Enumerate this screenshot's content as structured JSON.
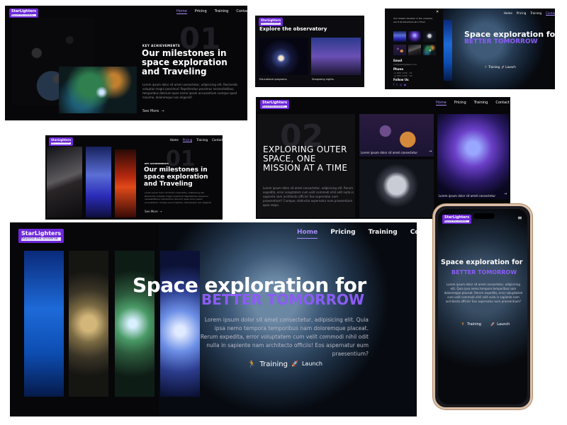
{
  "brand": {
    "name": "StarLighters",
    "tagline": "Beyond the universe"
  },
  "nav": {
    "home": "Home",
    "pricing": "Pricing",
    "training": "Training",
    "contact": "Contact"
  },
  "milestones": {
    "kicker": "KEY ACHIEVEMENTS",
    "title": "Our milestones in space exploration and Traveling",
    "ghost_number": "01",
    "body": "Lorem ipsum dolor sit amet consectetur, adipisicing elit. Reiciendis voluptas magni possimus! Repellendus possimus necessitatibus, temporibus dolorum quas nemo ipsam accusantium cumque quod maxime, doloremque non eligendi!",
    "see_more": "See More"
  },
  "observatory": {
    "title": "Explore the observatory",
    "cards": [
      {
        "caption": "Educational programs."
      },
      {
        "caption": "Stargazing nights."
      }
    ]
  },
  "contact_panel": {
    "intro": "Your Dream Vacation in the universe, are it all Adventure at a Time!",
    "email_label": "Email",
    "email_value": "info@starlighters.com",
    "phone_label": "Phone",
    "phone_values": [
      "+1 800 1234 - 01",
      "+1 800 1234 - 02"
    ],
    "follow_label": "Follow Us"
  },
  "hero": {
    "title_line1": "Space exploration for",
    "title_line2": "BETTER TOMORROW",
    "body": "Lorem ipsum dolor sit amet consectetur, adipisicing elit. Quia ipsa nemo tempora temporibus nam doloremque placeat. Rerum expedita, error voluptatem cum velit commodi nihil odit nulla in sapiente nam architecto officiis! Eos aspernatur eum praesentium?",
    "training_label": "Training",
    "launch_label": "Launch"
  },
  "mission": {
    "ghost_number": "02",
    "title": "EXPLORING OUTER SPACE, ONE MISSION AT A TIME",
    "body": "Lorem ipsum dolor sit amet consectetur, adipisicing elit. Rerum expedita, error voluptatem cum velit commodi nihil odit nulla in sapiente nam architecto officiis! Eos aspernatur eum praesentium? Cumque, distinctio aspernatur eum praesentium quos sequi.",
    "cards": [
      {
        "caption": "Lorem ipsum dolor sit amet consectetur"
      },
      {
        "caption": "Lorem ipsum dolor sit amet consectetur"
      }
    ]
  },
  "colors": {
    "accent": "#8b5cf6",
    "brand_purple": "#6d28d9",
    "background": "#070709"
  }
}
